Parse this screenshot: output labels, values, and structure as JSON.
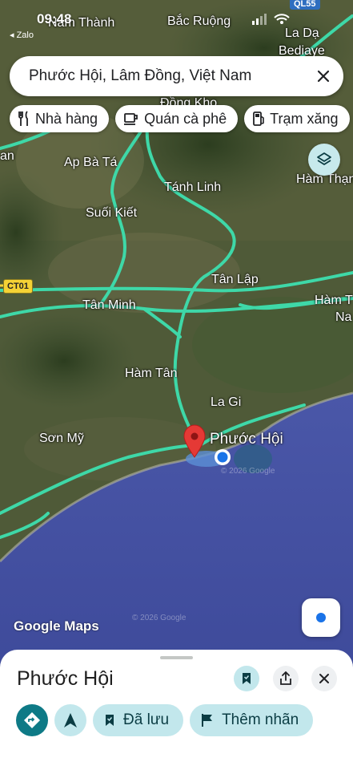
{
  "status": {
    "time": "09:48",
    "back_app": "◂ Zalo"
  },
  "search": {
    "query": "Phước Hội, Lâm Đồng, Việt Nam"
  },
  "chips": [
    {
      "icon": "restaurant-icon",
      "label": "Nhà hàng"
    },
    {
      "icon": "coffee-icon",
      "label": "Quán cà phê"
    },
    {
      "icon": "gas-station-icon",
      "label": "Trạm xăng"
    }
  ],
  "map": {
    "places": {
      "nam_thanh": "Nam Thành",
      "bac_ruong": "Bắc Ruộng",
      "la_da": "La Dạ",
      "bediaye": "Bediaye",
      "dong_kho": "Đồng Kho",
      "ap_ba_ta": "Ap Bà Tá",
      "tanh_linh": "Tánh Linh",
      "ham_thuan": "Hàm Thạn",
      "suoi_kiet": "Suối Kiết",
      "tan_lap": "Tân Lập",
      "tan_minh": "Tân Minh",
      "ham_t": "Hàm T",
      "na": "Na",
      "ham_tan": "Hàm Tân",
      "la_gi": "La Gi",
      "son_my": "Sơn Mỹ",
      "phuoc_hoi": "Phước Hội",
      "an": "an"
    },
    "road_badges": {
      "ct01": "CT01",
      "ql55": "QL55"
    },
    "logo": "Google Maps",
    "copyright_1": "© 2026 Google",
    "copyright_2": "© 2026 Google"
  },
  "sheet": {
    "title": "Phước Hội",
    "actions": {
      "saved_label": "Đã lưu",
      "add_label": "Thêm nhãn"
    }
  },
  "colors": {
    "accent": "#0e7a86",
    "saved_bg": "#c2e7ec",
    "road": "#3ed8a8",
    "sea": "#3b4a9e",
    "pin": "#e53935"
  }
}
